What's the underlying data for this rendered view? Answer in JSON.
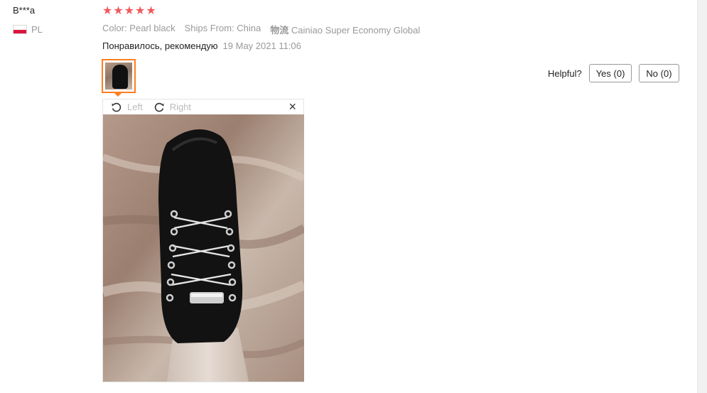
{
  "reviewer": {
    "name": "B***a",
    "country": "PL"
  },
  "rating": {
    "stars": 5,
    "max": 5,
    "star_glyph": "★",
    "color": "#f2585c"
  },
  "meta": {
    "color": "Color: Pearl black",
    "ships_from": "Ships From: China",
    "logistics_label": "物流",
    "logistics_value": "Cainiao Super Economy Global"
  },
  "review": {
    "text": "Понравилось, рекомендую",
    "date": "19 May 2021 11:06"
  },
  "viewer": {
    "left_label": "Left",
    "right_label": "Right",
    "close_glyph": "×",
    "thumbnail_border_color": "#ff7e21"
  },
  "helpful": {
    "label": "Helpful?",
    "yes": "Yes (0)",
    "no": "No (0)"
  }
}
